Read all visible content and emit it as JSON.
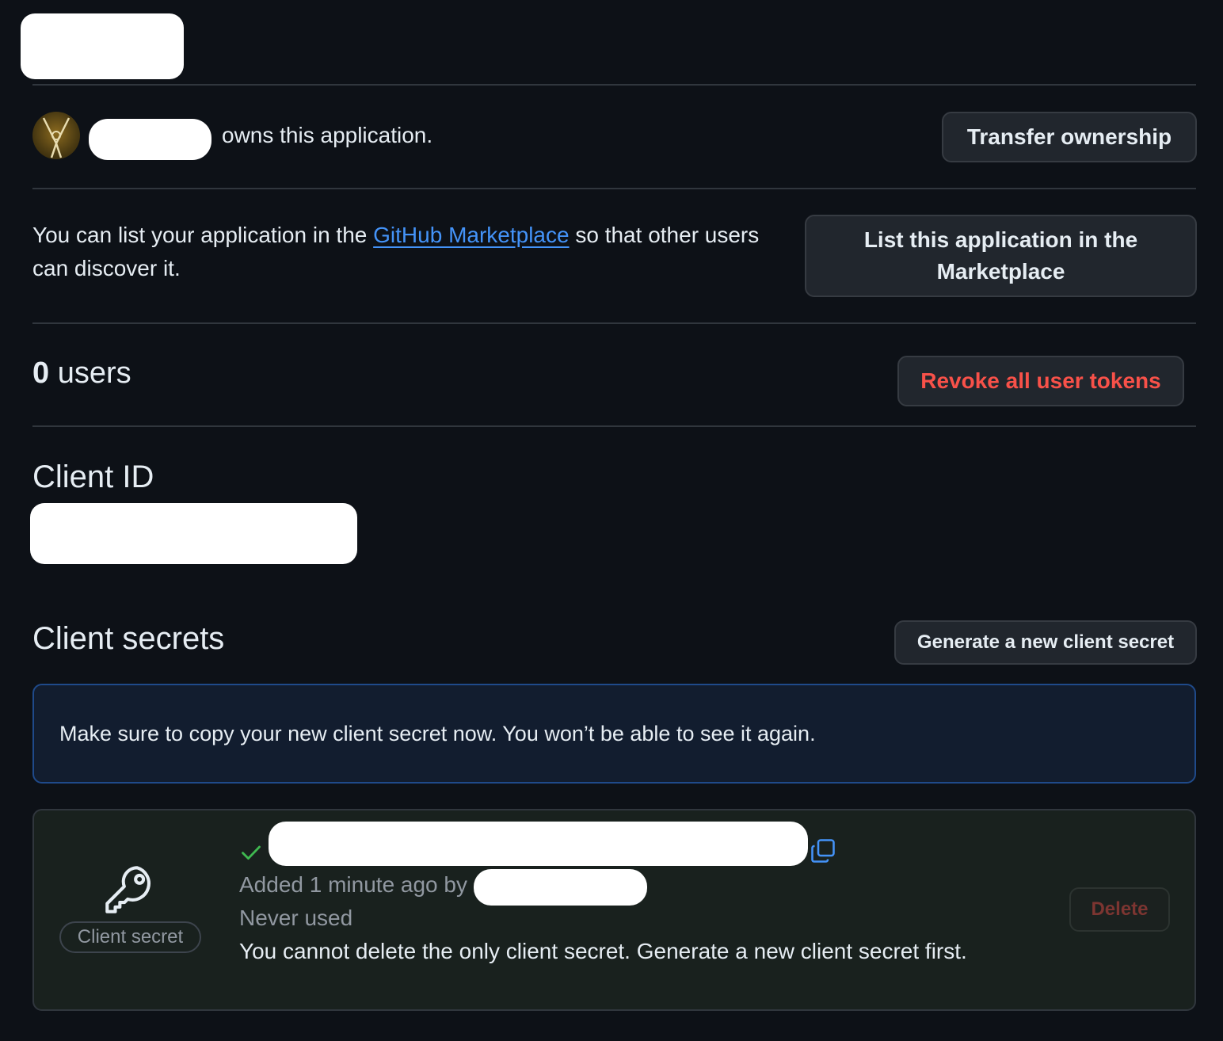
{
  "owner": {
    "owns_text": "owns this application.",
    "transfer_button": "Transfer ownership"
  },
  "marketplace": {
    "text_before": "You can list your application in the ",
    "link_text": "GitHub Marketplace",
    "text_after": " so that other users",
    "text_line2": "can discover it.",
    "list_button_line1": "List this application in the",
    "list_button_line2": "Marketplace"
  },
  "users": {
    "count": "0",
    "label": "users",
    "revoke_button": "Revoke all user tokens"
  },
  "client_id": {
    "heading": "Client ID"
  },
  "client_secrets": {
    "heading": "Client secrets",
    "generate_button": "Generate a new client secret",
    "flash_message": "Make sure to copy your new client secret now. You won’t be able to see it again.",
    "badge": "Client secret",
    "added_text": "Added 1 minute ago by",
    "usage": "Never used",
    "note": "You cannot delete the only client secret. Generate a new client secret first.",
    "delete_button": "Delete"
  },
  "colors": {
    "background": "#0d1117",
    "link": "#4493f8",
    "danger": "#f85149",
    "success": "#3fb950"
  },
  "icons": {
    "check": "check-icon",
    "copy": "copy-icon",
    "key": "key-icon"
  }
}
